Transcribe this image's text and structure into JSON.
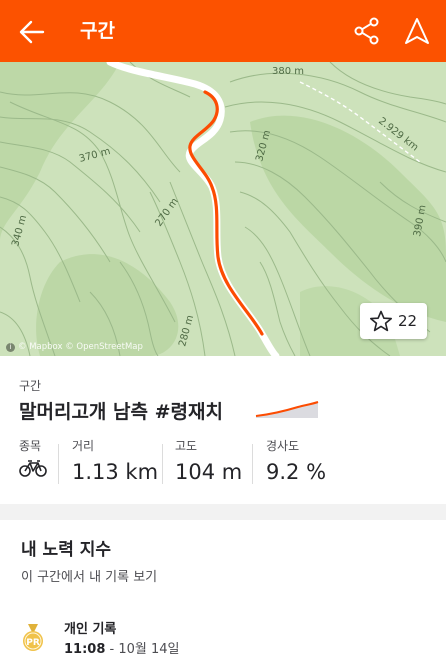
{
  "appbar": {
    "title": "구간",
    "bg_color": "#fc5200"
  },
  "map": {
    "contour_labels": [
      "380 m",
      "370 m",
      "320 m",
      "270 m",
      "340 m",
      "280 m",
      "390 m"
    ],
    "distance_label": "2.929 km",
    "attribution": "© Mapbox © OpenStreetMap",
    "route_color": "#fc4c02",
    "star_count": "22"
  },
  "segment": {
    "section_label": "구간",
    "name": "말머리고개 남측 #령재치",
    "stats": [
      {
        "label": "종목",
        "value": ""
      },
      {
        "label": "거리",
        "value": "1.13 km"
      },
      {
        "label": "고도",
        "value": "104 m"
      },
      {
        "label": "경사도",
        "value": "9.2 %"
      }
    ]
  },
  "effort": {
    "title": "내 노력 지수",
    "subtitle": "이 구간에서 내 기록 보기",
    "pr_badge": "PR",
    "pr_title": "개인 기록",
    "pr_time": "11:08",
    "pr_date": " - 10월 14일"
  }
}
